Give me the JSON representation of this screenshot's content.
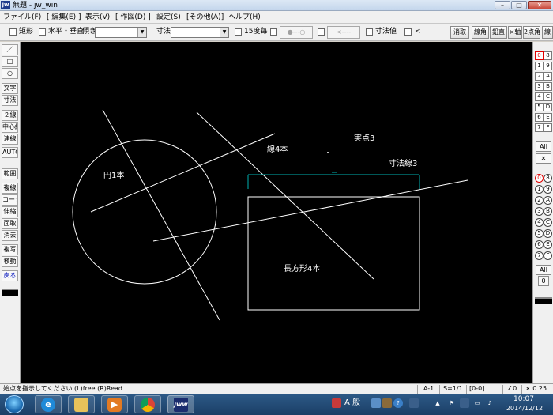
{
  "window": {
    "title": "無題 - jw_win",
    "app_icon": "jw",
    "controls": {
      "minimize": "–",
      "maximize": "□",
      "close": "✕"
    }
  },
  "menu": {
    "items": [
      "ファイル(F)",
      "[ 編集(E) ]",
      "表示(V)",
      "[ 作図(D) ]",
      "設定(S)",
      "[その他(A)]",
      "ヘルプ(H)"
    ]
  },
  "toolbar": {
    "rect_label": "矩形",
    "hv_label": "水平・垂直",
    "tilt_label": "傾き",
    "tilt_value": "",
    "dim_label": "寸法",
    "dim_value": "",
    "deg15_label": "15度毎",
    "arrow_btn1": "●---○",
    "arrow_btn2": "<----",
    "dimval_label": "寸法値",
    "lt_label": "<",
    "buttons": [
      "消取",
      "線角",
      "鉛直",
      "×軸",
      "2点角",
      "線"
    ]
  },
  "left_tools": {
    "group1": [
      "／",
      "□",
      "○",
      "文字",
      "寸法",
      "２線",
      "中心線",
      "連線",
      "AUTO"
    ],
    "group2": [
      "範囲",
      "複線",
      "コーナー",
      "伸縮",
      "面取",
      "消去",
      "複写",
      "移動",
      "戻る"
    ]
  },
  "canvas": {
    "labels": {
      "circle": "円1本",
      "lines": "線4本",
      "points": "実点3",
      "dims": "寸法線3",
      "rect": "長方形4本"
    },
    "colors": {
      "background": "#000000",
      "entity": "#ffffff",
      "dimension": "#00b0b0"
    }
  },
  "right_layers": {
    "layers": [
      "0",
      "1",
      "2",
      "3",
      "4",
      "5",
      "6",
      "7"
    ],
    "groups": [
      "8",
      "9",
      "A",
      "B",
      "C",
      "D",
      "E",
      "F"
    ],
    "active_layer": "0",
    "all_label": "All",
    "cross_label": "✕",
    "group_layers": [
      "0",
      "1",
      "2",
      "3",
      "4",
      "5",
      "6",
      "7"
    ],
    "group_groups": [
      "8",
      "9",
      "A",
      "B",
      "C",
      "D",
      "E",
      "F"
    ],
    "active_group": "0",
    "all2_label": "All",
    "zero_label": "0"
  },
  "status": {
    "message": "始点を指示してください (L)free (R)Read",
    "paper": "A-1",
    "scale": "S=1/1",
    "layer": "[0-0]",
    "angle": "∠0",
    "zoom": "× 0.25"
  },
  "taskbar": {
    "ime": "A 般",
    "time": "10:07",
    "date": "2014/12/12",
    "jww_label": "jww"
  }
}
